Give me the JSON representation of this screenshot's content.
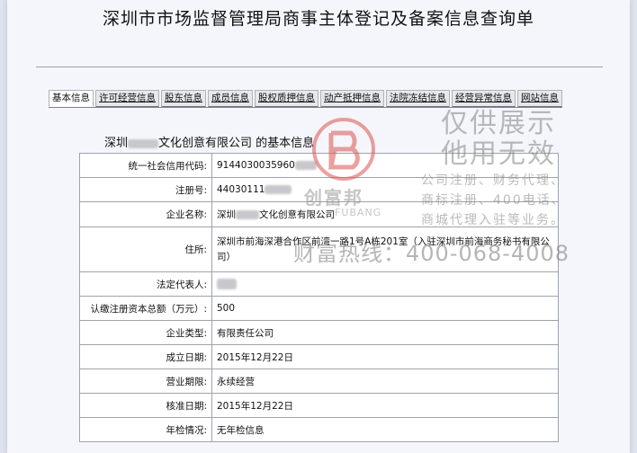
{
  "document": {
    "title": "深圳市市场监督管理局商事主体登记及备案信息查询单",
    "subtitle_prefix": "深圳",
    "subtitle_suffix": "文化创意有限公司 的基本信息"
  },
  "tabs": [
    {
      "label": "基本信息",
      "active": true
    },
    {
      "label": "许可经营信息",
      "active": false
    },
    {
      "label": "股东信息",
      "active": false
    },
    {
      "label": "成员信息",
      "active": false
    },
    {
      "label": "股权质押信息",
      "active": false
    },
    {
      "label": "动产抵押信息",
      "active": false
    },
    {
      "label": "法院冻结信息",
      "active": false
    },
    {
      "label": "经营异常信息",
      "active": false
    },
    {
      "label": "网站信息",
      "active": false
    }
  ],
  "rows": {
    "credit_code": {
      "label": "统一社会信用代码:",
      "value": "9144030035960"
    },
    "reg_no": {
      "label": "注册号:",
      "value": "44030111"
    },
    "name": {
      "label": "企业名称:",
      "value_prefix": "深圳",
      "value_suffix": "文化创意有限公司"
    },
    "address": {
      "label": "住所:",
      "value": "深圳市前海深港合作区前湾一路1号A栋201室（入驻深圳市前海商务秘书有限公司）"
    },
    "legal_rep": {
      "label": "法定代表人:"
    },
    "capital": {
      "label": "认缴注册资本总额（万元）:",
      "value": "500"
    },
    "type": {
      "label": "企业类型:",
      "value": "有限责任公司"
    },
    "established": {
      "label": "成立日期:",
      "value": "2015年12月22日"
    },
    "term": {
      "label": "营业期限:",
      "value": "永续经营"
    },
    "approved": {
      "label": "核准日期:",
      "value": "2015年12月22日"
    },
    "annual": {
      "label": "年检情况:",
      "value": "无年检信息"
    }
  },
  "watermark": {
    "brand": "创富邦",
    "brand_en": "FUBANG",
    "line1": "仅供展示",
    "line2": "他用无效",
    "services1": "公司注册、财务代理、",
    "services2": "商标注册、400电话、",
    "services3": "商城代理入驻等业务。",
    "phone": "财富热线：400-068-4008"
  },
  "colors": {
    "logo": "#d9534f"
  }
}
